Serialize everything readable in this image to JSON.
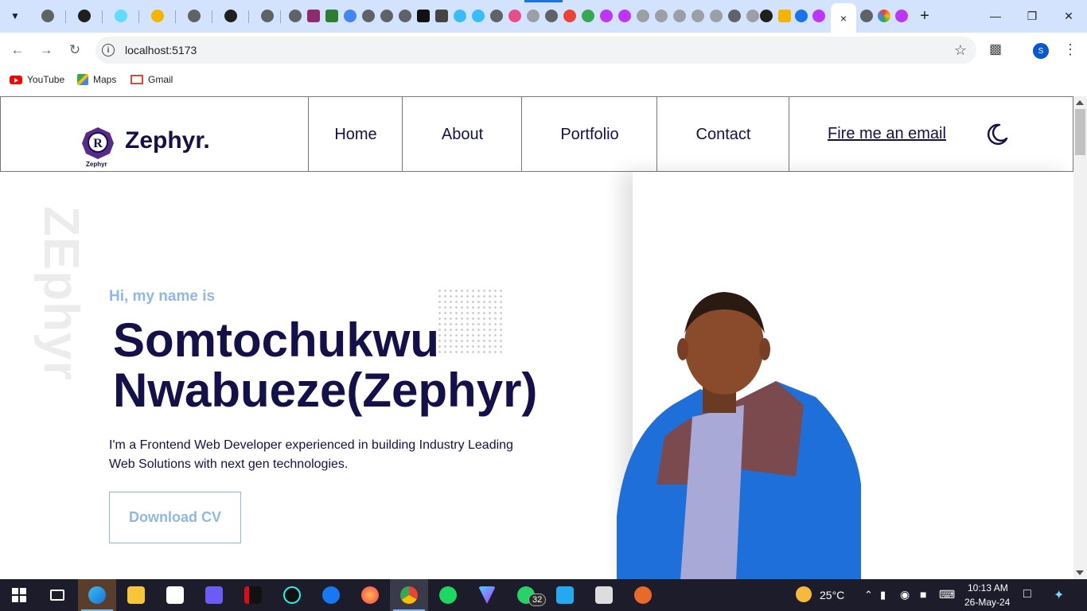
{
  "browser": {
    "url": "localhost:5173",
    "active_tab_close": "×",
    "new_tab": "+",
    "bookmarks": [
      {
        "label": "YouTube",
        "icon": "youtube-icon"
      },
      {
        "label": "Maps",
        "icon": "maps-icon"
      },
      {
        "label": "Gmail",
        "icon": "gmail-icon"
      }
    ]
  },
  "site": {
    "brand": "Zephyr.",
    "logo_caption": "Zephyr",
    "nav": [
      "Home",
      "About",
      "Portfolio",
      "Contact"
    ],
    "email_link": "Fire me an email",
    "vertical_text": "ZEphyr",
    "greeting": "Hi, my name is",
    "name_line1": "Somtochukwu",
    "name_line2": "Nwabueze(Zephyr)",
    "bio": "I'm a Frontend Web Developer experienced in building Industry Leading Web Solutions with next gen technologies.",
    "cta": "Download CV",
    "colors": {
      "primary": "#14104a",
      "accent": "#8fb8e6"
    }
  },
  "taskbar": {
    "whatsapp_badge": "32",
    "temperature": "25°C",
    "time": "10:13 AM",
    "date": "26-May-24",
    "profile_initial": "S"
  }
}
